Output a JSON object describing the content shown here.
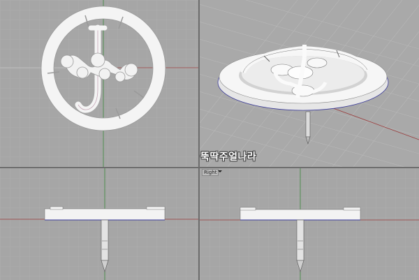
{
  "viewports": {
    "top": {
      "icon": "logo-ring-top-view"
    },
    "perspective": {
      "icon": "logo-pin-perspective-view"
    },
    "front": {
      "icon": "pin-front-view"
    },
    "right": {
      "label": "Right",
      "menu_icon": "chevron-down-icon"
    }
  },
  "watermark": "뚝딱주얼나라",
  "colors": {
    "viewport_bg": "#a6a6a6",
    "grid_minor": "#b3b3b3",
    "grid_major": "#c2c2c2",
    "axis_x": "#9a3a3a",
    "axis_y": "#3a8a3a",
    "model": "#f4f4f4",
    "shadow": "#9d9d9d",
    "selection_edge": "#3b3b9a"
  }
}
